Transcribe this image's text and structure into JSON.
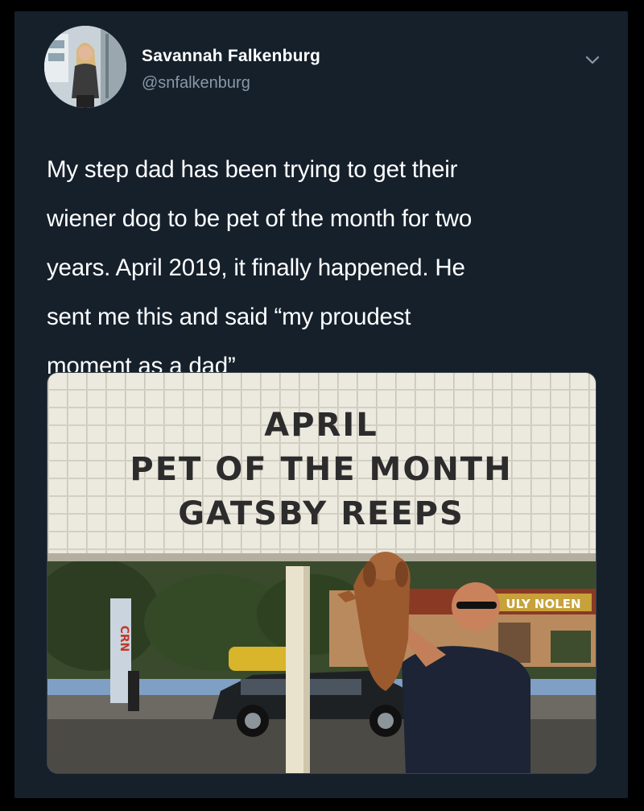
{
  "user": {
    "name": "Savannah Falkenburg",
    "handle": "@snfalkenburg"
  },
  "tweet": {
    "text": "My step dad has been trying to get their\nwiener dog to be pet of the month for two\nyears. April 2019, it finally happened. He\nsent me this and said “my proudest\nmoment as a dad”"
  },
  "photo": {
    "sign_line1": "APRIL",
    "sign_line2": "PET OF THE MONTH",
    "sign_line3": "GATSBY  REEPS",
    "store_sign": "ULY NOLEN",
    "side_banner": "CRN"
  },
  "icons": {
    "menu": "chevron-down-icon"
  },
  "colors": {
    "background": "#15202b",
    "text": "#ffffff",
    "secondary_text": "#8899a6"
  }
}
